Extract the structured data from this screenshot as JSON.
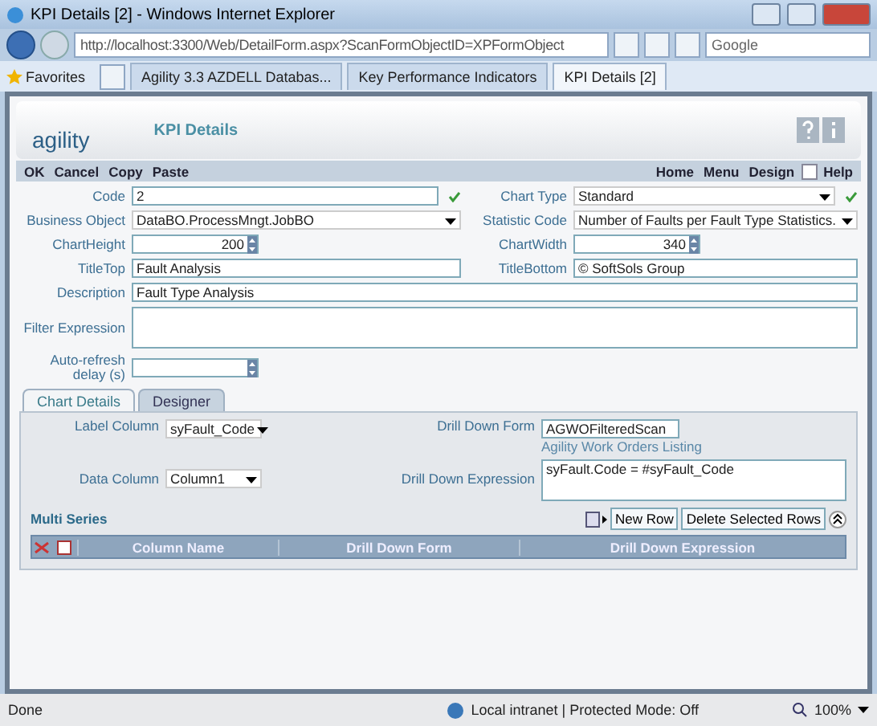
{
  "window": {
    "title": "KPI Details [2] - Windows Internet Explorer"
  },
  "browser": {
    "address": "http://localhost:3300/Web/DetailForm.aspx?ScanFormObjectID=XPFormObject",
    "search_placeholder": "Google",
    "favorites": "Favorites",
    "tabs": [
      {
        "label": "Agility 3.3 AZDELL Databas...",
        "selected": false
      },
      {
        "label": "Key Performance Indicators",
        "selected": false
      },
      {
        "label": "KPI Details [2]",
        "selected": true
      }
    ]
  },
  "app": {
    "logo": "agility",
    "title": "KPI Details"
  },
  "toolbar": {
    "left": [
      "OK",
      "Cancel",
      "Copy",
      "Paste"
    ],
    "home": "Home",
    "menu": "Menu",
    "design": {
      "label": "Design",
      "checked": false
    },
    "help": "Help"
  },
  "form": [
    {
      "fields": [
        {
          "label": "Code",
          "kind": "text",
          "value": "2",
          "valid": true
        },
        {
          "label": "Chart Type",
          "kind": "select",
          "value": "Standard",
          "valid": true
        }
      ]
    },
    {
      "fields": [
        {
          "label": "Business Object",
          "kind": "select",
          "value": "DataBO.ProcessMngt.JobBO",
          "valid": false
        },
        {
          "label": "Statistic Code",
          "kind": "select",
          "value": "Number of Faults per Fault Type Statistics.",
          "valid": false
        }
      ]
    },
    {
      "fields": [
        {
          "label": "ChartHeight",
          "kind": "spin",
          "value": "200",
          "valid": false
        },
        {
          "label": "ChartWidth",
          "kind": "spin",
          "value": "340",
          "valid": false
        }
      ]
    },
    {
      "fields": [
        {
          "label": "TitleTop",
          "kind": "text",
          "value": "Fault Analysis",
          "valid": false
        },
        {
          "label": "TitleBottom",
          "kind": "text",
          "value": "© SoftSols Group",
          "valid": false
        }
      ]
    },
    {
      "fields": [
        {
          "label": "Description",
          "kind": "text",
          "value": "Fault Type Analysis",
          "valid": false
        }
      ]
    },
    {
      "fields": [
        {
          "label": "Filter Expression",
          "kind": "textarea",
          "valid": false
        }
      ]
    },
    {
      "fields": [
        {
          "label": "Auto-refresh delay (s)",
          "kind": "spin",
          "valid": false
        }
      ]
    }
  ],
  "tabs": [
    {
      "label": "Chart Details",
      "selected": true
    },
    {
      "label": "Designer",
      "selected": false
    }
  ],
  "chart_details": {
    "label_column": {
      "label": "Label Column",
      "value": "syFault_Code"
    },
    "data_column": {
      "label": "Data Column",
      "value": "Column1"
    },
    "drill_down_form": {
      "label": "Drill Down Form",
      "value": "AGWOFilteredScan",
      "caption": "Agility Work Orders Listing"
    },
    "drill_down_expression": {
      "label": "Drill Down Expression",
      "value": "syFault.Code = #syFault_Code"
    },
    "multi_series": {
      "title": "Multi Series",
      "buttons": [
        "New Row",
        "Delete Selected Rows"
      ],
      "columns": [
        "Column Name",
        "Drill Down Form",
        "Drill Down Expression"
      ]
    }
  },
  "status_bar": {
    "status": "Done",
    "zone": "Local intranet | Protected Mode: Off",
    "zoom": "100%"
  }
}
